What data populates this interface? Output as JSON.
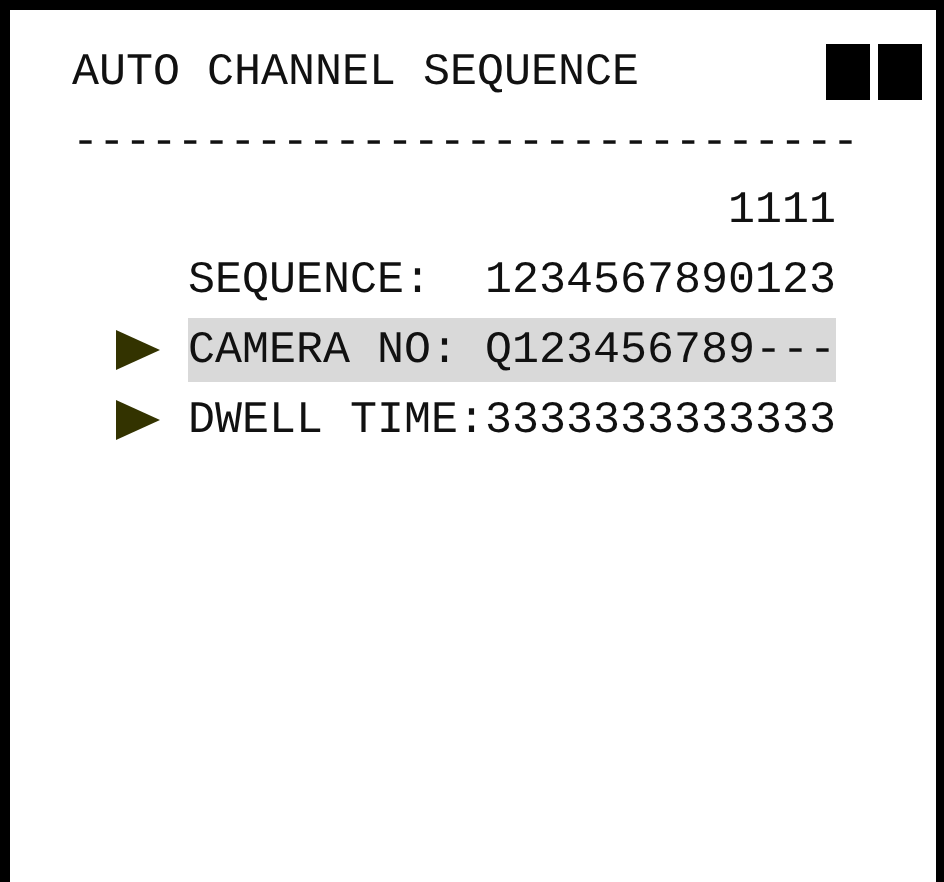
{
  "title": "AUTO CHANNEL SEQUENCE",
  "separator": "------------------------------",
  "counter": "1111",
  "rows": [
    {
      "label": "SEQUENCE:",
      "value": "1234567890123",
      "pointer": false,
      "selected": false
    },
    {
      "label": "CAMERA NO:",
      "value": "Q123456789---",
      "pointer": true,
      "selected": true
    },
    {
      "label": "DWELL TIME:",
      "value": "3333333333333",
      "pointer": true,
      "selected": false
    }
  ]
}
